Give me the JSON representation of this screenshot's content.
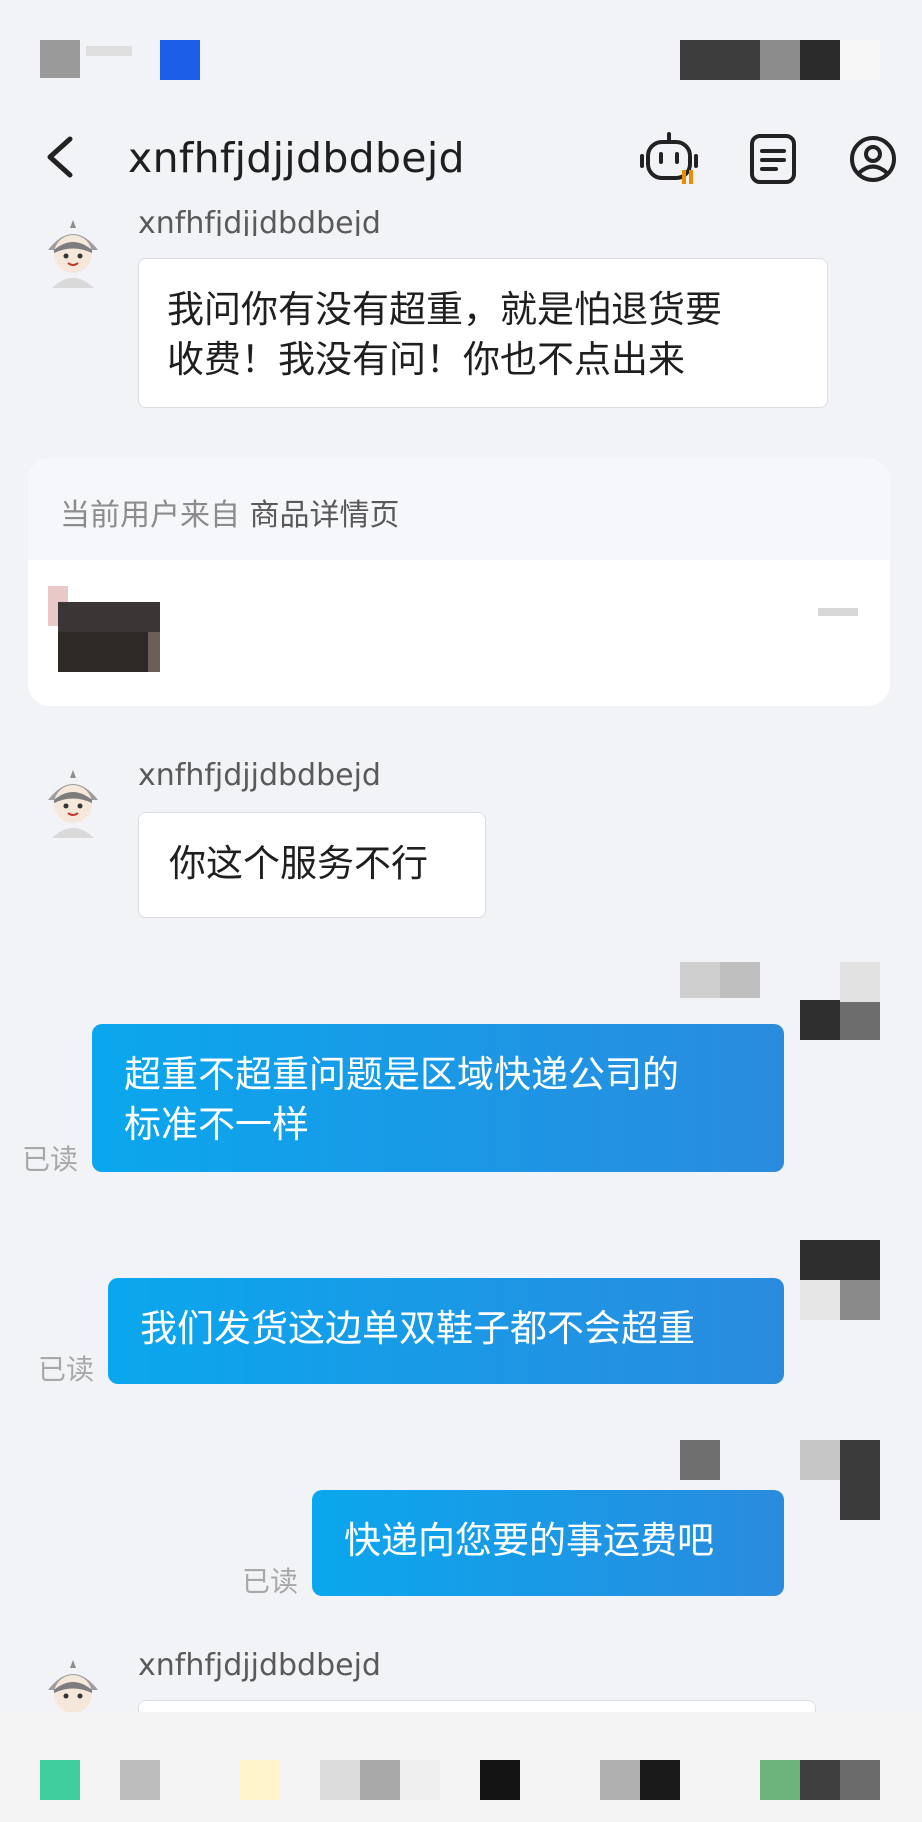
{
  "header": {
    "title": "xnfhfjdjjdbdbejd"
  },
  "messages": [
    {
      "id": "m1",
      "direction": "in",
      "sender": "xnfhfjdjjdbdbejd",
      "lines": [
        "我问你有没有超重，就是怕退货要",
        "收费！我没有问！你也不点出来"
      ]
    },
    {
      "id": "m2",
      "direction": "in",
      "sender": "xnfhfjdjjdbdbejd",
      "lines": [
        "你这个服务不行"
      ]
    },
    {
      "id": "m3",
      "direction": "out",
      "read": "已读",
      "lines": [
        "超重不超重问题是区域快递公司的",
        "标准不一样"
      ]
    },
    {
      "id": "m4",
      "direction": "out",
      "read": "已读",
      "lines": [
        "我们发货这边单双鞋子都不会超重"
      ]
    },
    {
      "id": "m5",
      "direction": "out",
      "read": "已读",
      "lines": [
        "快递向您要的事运费吧"
      ]
    },
    {
      "id": "m6",
      "direction": "in",
      "sender": "xnfhfjdjjdbdbejd",
      "lines": []
    }
  ],
  "source_card": {
    "prefix": "当前用户来自",
    "page": "商品详情页"
  },
  "colors": {
    "background": "#f1f3f7",
    "outgoing_bubble": "#1a9ae8",
    "incoming_bubble": "#ffffff",
    "read_text": "#a8a8a8"
  },
  "icons": {
    "back": "chevron-left-icon",
    "robot": "robot-icon",
    "notes": "document-list-icon",
    "profile": "user-circle-icon"
  }
}
